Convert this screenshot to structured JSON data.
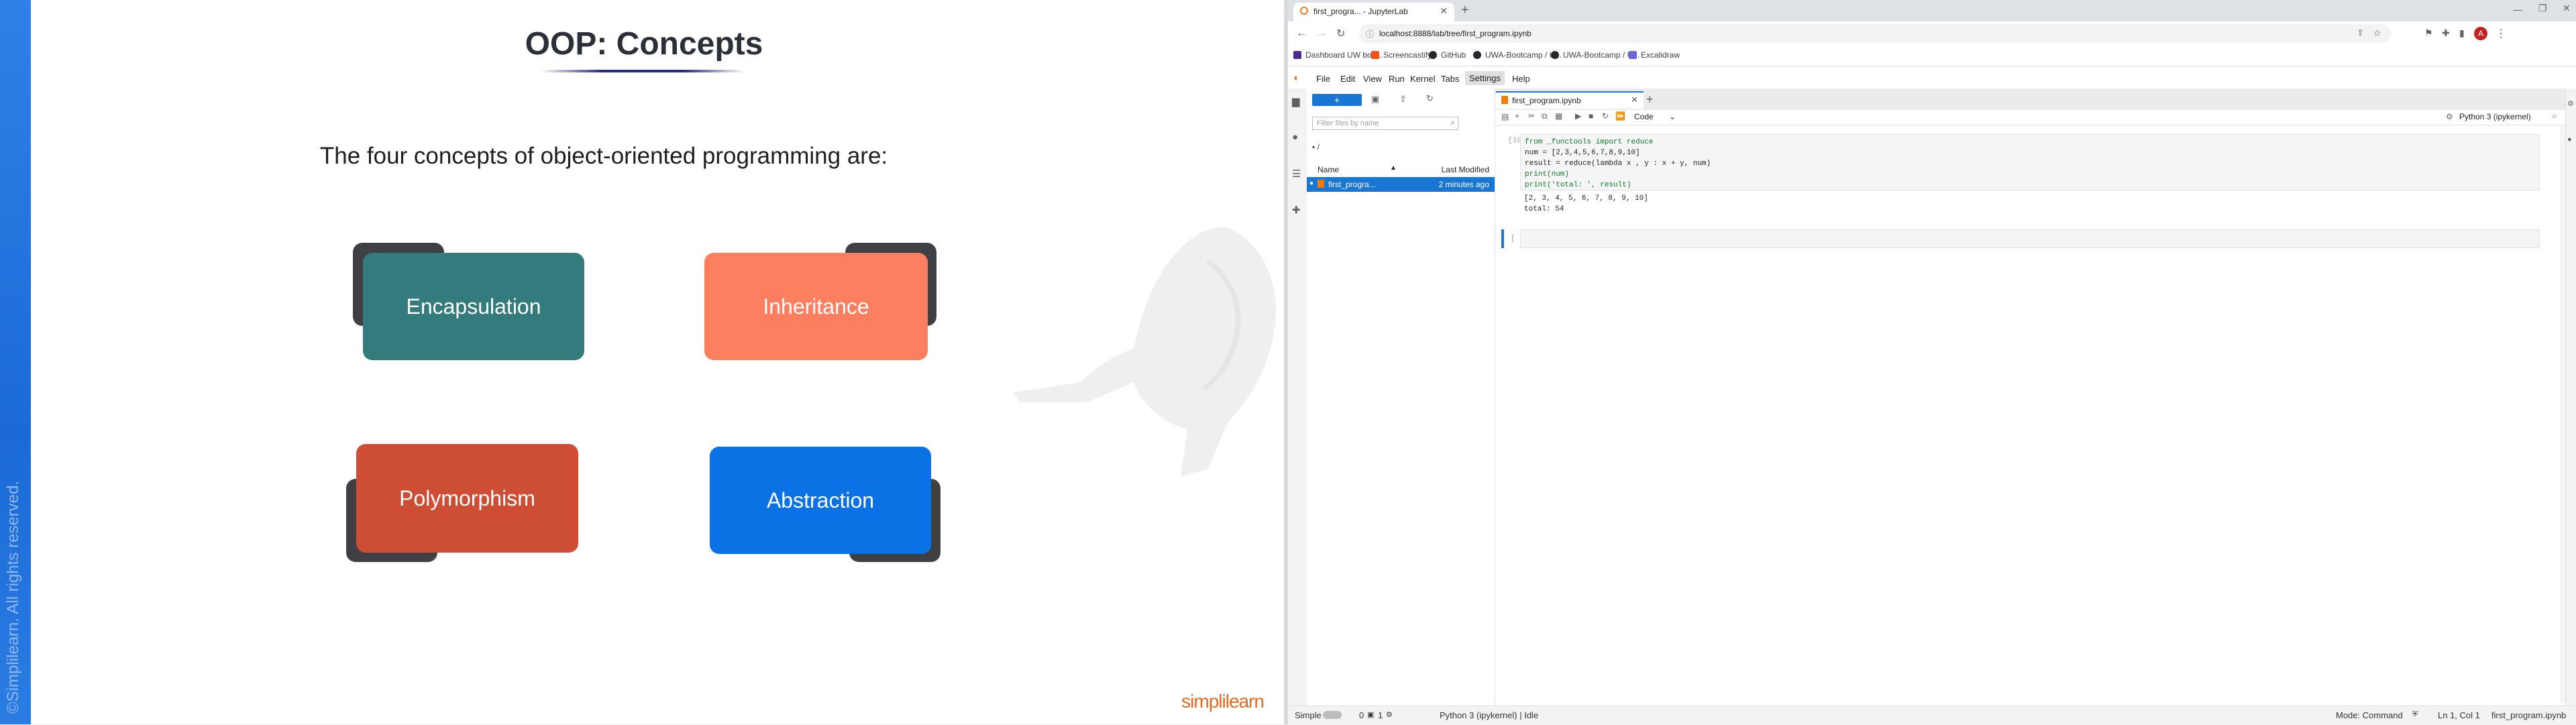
{
  "slide": {
    "title": "OOP: Concepts",
    "subtitle": "The four concepts of object-oriented programming are:",
    "concepts": [
      "Encapsulation",
      "Inheritance",
      "Polymorphism",
      "Abstraction"
    ],
    "copyright": "©Simplilearn. All rights reserved.",
    "logo": "simplilearn",
    "colors": {
      "encapsulation": "#337b7d",
      "inheritance": "#fd7f5f",
      "polymorphism": "#cd4e34",
      "abstraction": "#0b72e5",
      "stripe": "#2a7ae2"
    }
  },
  "browser": {
    "tab_title": "first_progra... - JupyterLab",
    "new_tab_icon": "plus-icon",
    "url": "localhost:8888/lab/tree/first_program.ipynb",
    "profile_initial": "A",
    "bookmarks": [
      "Dashboard UW boo...",
      "Screencastify",
      "GitHub",
      "UWA-Bootcamp / U...",
      "UWA-Bootcamp / U...",
      "Excalidraw"
    ]
  },
  "jupyter": {
    "menu": [
      "File",
      "Edit",
      "View",
      "Run",
      "Kernel",
      "Tabs",
      "Settings",
      "Help"
    ],
    "active_menu": "Settings",
    "filebrowser": {
      "filter_placeholder": "Filter files by name",
      "path": "/",
      "col_name": "Name",
      "col_modified": "Last Modified",
      "files": [
        {
          "name": "first_progra...",
          "modified": "2 minutes ago"
        }
      ]
    },
    "notebook": {
      "tab_label": "first_program.ipynb",
      "cell_type": "Code",
      "kernel": "Python 3 (ipykernel)",
      "cell1_prompt": "[10]:",
      "cell1_code": [
        "from _functools import reduce",
        "num = [2,3,4,5,6,7,8,9,10]",
        "result = reduce(lambda x , y : x + y, num)",
        "print(num)",
        "print('total: ', result)"
      ],
      "cell1_output": [
        "[2, 3, 4, 5, 6, 7, 8, 9, 10]",
        "total:  54"
      ],
      "cell2_prompt": "[ ]:"
    },
    "status": {
      "mode_toggle": "Simple",
      "counts_a": "0",
      "counts_b": "1",
      "kernel_status": "Python 3 (ipykernel) | Idle",
      "mode": "Mode: Command",
      "cursor": "Ln 1, Col 1",
      "file": "first_program.ipynb"
    }
  }
}
